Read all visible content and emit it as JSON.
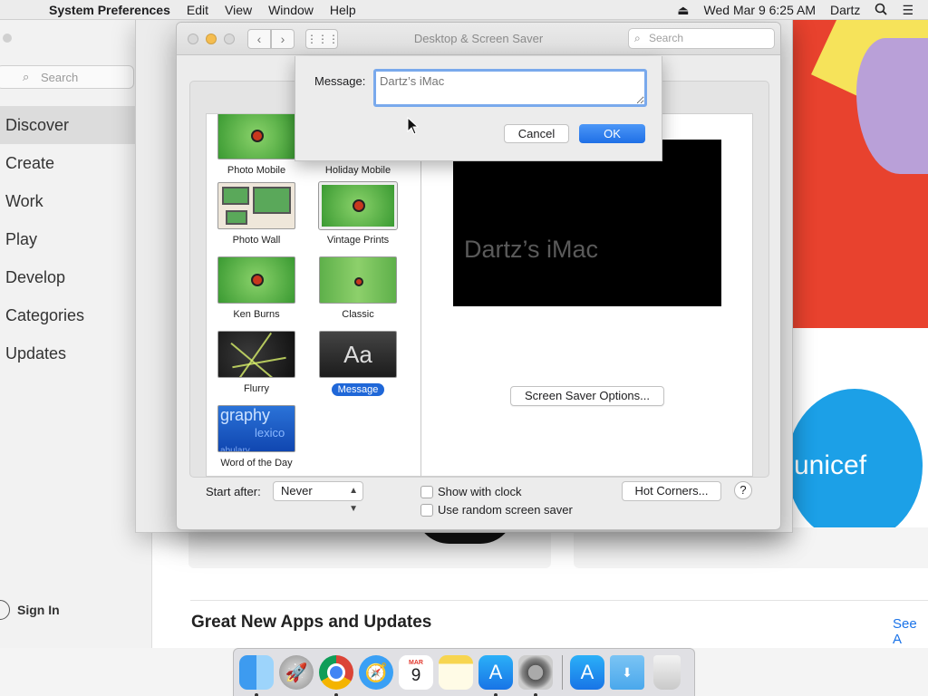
{
  "menubar": {
    "apple_icon": "apple-icon",
    "app_name": "System Preferences",
    "menus": [
      "Edit",
      "View",
      "Window",
      "Help"
    ],
    "datetime": "Wed Mar 9  6:25 AM",
    "user": "Dartz"
  },
  "appstore": {
    "search_placeholder": "Search",
    "nav": [
      "Discover",
      "Create",
      "Work",
      "Play",
      "Develop",
      "Categories",
      "Updates"
    ],
    "active_nav": "Discover",
    "sign_in": "Sign In",
    "section_title": "Great New Apps and Updates",
    "see_all": "See A",
    "banner_text": "unicef"
  },
  "window": {
    "title": "Desktop & Screen Saver",
    "search_placeholder": "Search",
    "back_glyph": "‹",
    "forward_glyph": "›",
    "grid_glyph": "⋮⋮⋮"
  },
  "savers": [
    {
      "label": "Photo Mobile"
    },
    {
      "label": "Holiday Mobile"
    },
    {
      "label": "Photo Wall"
    },
    {
      "label": "Vintage Prints"
    },
    {
      "label": "Ken Burns"
    },
    {
      "label": "Classic"
    },
    {
      "label": "Flurry"
    },
    {
      "label": "Message",
      "selected": true
    },
    {
      "label": "Word of the Day"
    }
  ],
  "word_of_day_thumb": [
    "graphy",
    "lexico",
    "abulary"
  ],
  "message_thumb": "Aa",
  "preview": {
    "name": "Dartz’s iMac"
  },
  "options_button": "Screen Saver Options...",
  "start_after": {
    "label": "Start after:",
    "value": "Never"
  },
  "checkboxes": {
    "show_clock": "Show with clock",
    "random": "Use random screen saver"
  },
  "hot_corners": "Hot Corners...",
  "help": "?",
  "sheet": {
    "label": "Message:",
    "input_placeholder": "Dartz’s iMac",
    "cancel": "Cancel",
    "ok": "OK"
  },
  "dock": {
    "calendar_month": "MAR",
    "calendar_day": "9",
    "items": [
      "finder-icon",
      "launchpad-icon",
      "chrome-icon",
      "safari-icon",
      "calendar-icon",
      "notes-icon",
      "app-store-icon",
      "system-preferences-icon",
      "app-store-download-icon",
      "downloads-folder-icon",
      "trash-icon"
    ]
  }
}
